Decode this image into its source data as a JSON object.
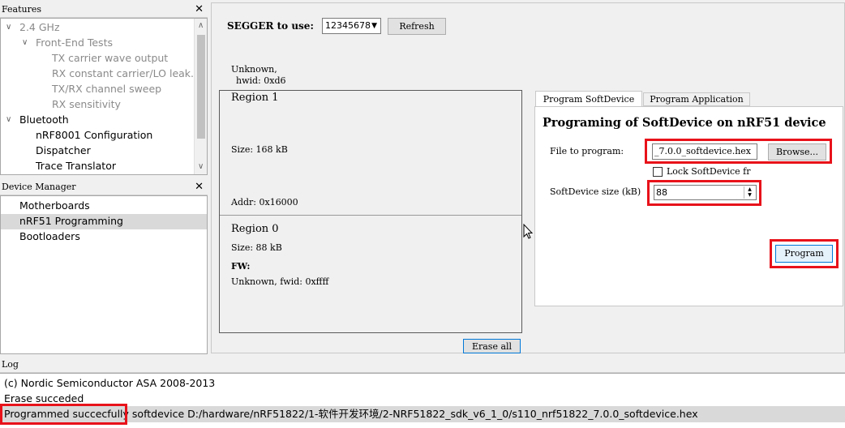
{
  "features": {
    "title": "Features",
    "items": [
      {
        "label": "2.4 GHz",
        "expanded": true
      },
      {
        "label": "Front-End Tests",
        "expanded": true
      },
      {
        "label": "TX carrier wave output"
      },
      {
        "label": "RX constant carrier/LO leak..."
      },
      {
        "label": "TX/RX channel sweep"
      },
      {
        "label": "RX sensitivity"
      },
      {
        "label": "Bluetooth",
        "expanded": true
      },
      {
        "label": "nRF8001 Configuration"
      },
      {
        "label": "Dispatcher"
      },
      {
        "label": "Trace Translator"
      }
    ]
  },
  "device_manager": {
    "title": "Device Manager",
    "items": [
      {
        "label": "Motherboards"
      },
      {
        "label": "nRF51 Programming",
        "selected": true
      },
      {
        "label": "Bootloaders"
      }
    ]
  },
  "segger": {
    "label": "SEGGER to use:",
    "value": "12345678",
    "refresh": "Refresh"
  },
  "device_info": {
    "line1": "Unknown,",
    "line2": "hwid: 0xd6"
  },
  "regions": [
    {
      "title": "Region 1",
      "size": "Size: 168 kB",
      "addr": "Addr:  0x16000"
    },
    {
      "title": "Region 0",
      "size": "Size: 88 kB",
      "fw_label": "FW:",
      "fw_info": "Unknown,  fwid: 0xffff"
    }
  ],
  "erase_all": "Erase all",
  "tabs": [
    {
      "label": "Program SoftDevice",
      "active": true
    },
    {
      "label": "Program Application",
      "active": false
    }
  ],
  "softdevice": {
    "heading": "Programing of SoftDevice on nRF51 device",
    "file_label": "File to program:",
    "file_value": "_7.0.0_softdevice.hex",
    "browse": "Browse...",
    "lock_label": "Lock SoftDevice fr",
    "size_label": "SoftDevice size (kB)",
    "size_value": "88",
    "program": "Program"
  },
  "log": {
    "title": "Log",
    "lines": [
      "(c) Nordic Semiconductor ASA 2008-2013",
      "Erase succeded",
      "Programmed succecfully"
    ],
    "line3_rest": " softdevice D:/hardware/nRF51822/1-软件开发环境/2-NRF51822_sdk_v6_1_0/s110_nrf51822_7.0.0_softdevice.hex"
  },
  "highlight_color": "#e8121a"
}
